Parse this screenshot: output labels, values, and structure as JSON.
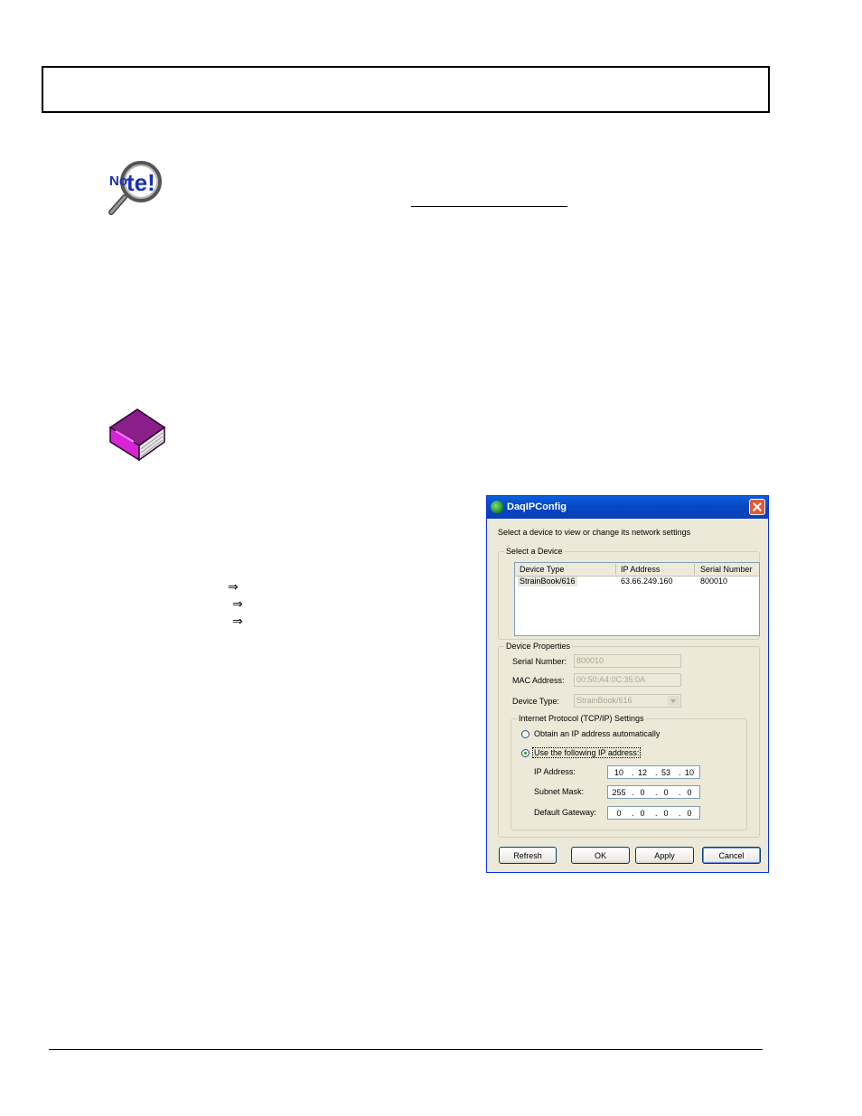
{
  "page": {
    "arrows": [
      "⇒",
      "⇒",
      "⇒"
    ]
  },
  "dialog": {
    "title": "DaqIPConfig",
    "instruction": "Select a device to view or change its network settings",
    "select_group_label": "Select a Device",
    "columns": [
      "Device Type",
      "IP Address",
      "Serial Number"
    ],
    "rows": [
      {
        "device_type": "StrainBook/616",
        "ip_address": "63.66.249.160",
        "serial_number": "800010"
      }
    ],
    "properties_group_label": "Device Properties",
    "serial_label": "Serial Number:",
    "serial_value": "800010",
    "mac_label": "MAC Address:",
    "mac_value": "00:50:A4:0C:35:0A",
    "device_type_label": "Device Type:",
    "device_type_value": "StrainBook/616",
    "tcpip_group_label": "Internet Protocol (TCP/IP) Settings",
    "radio_auto_label": "Obtain an IP address automatically",
    "radio_manual_label": "Use the following IP address:",
    "selected_mode": "manual",
    "ip_label": "IP Address:",
    "ip": [
      "10",
      "12",
      "53",
      "10"
    ],
    "mask_label": "Subnet Mask:",
    "mask": [
      "255",
      "0",
      "0",
      "0"
    ],
    "gateway_label": "Default Gateway:",
    "gateway": [
      "0",
      "0",
      "0",
      "0"
    ],
    "buttons": {
      "refresh": "Refresh",
      "ok": "OK",
      "apply": "Apply",
      "cancel": "Cancel"
    }
  }
}
